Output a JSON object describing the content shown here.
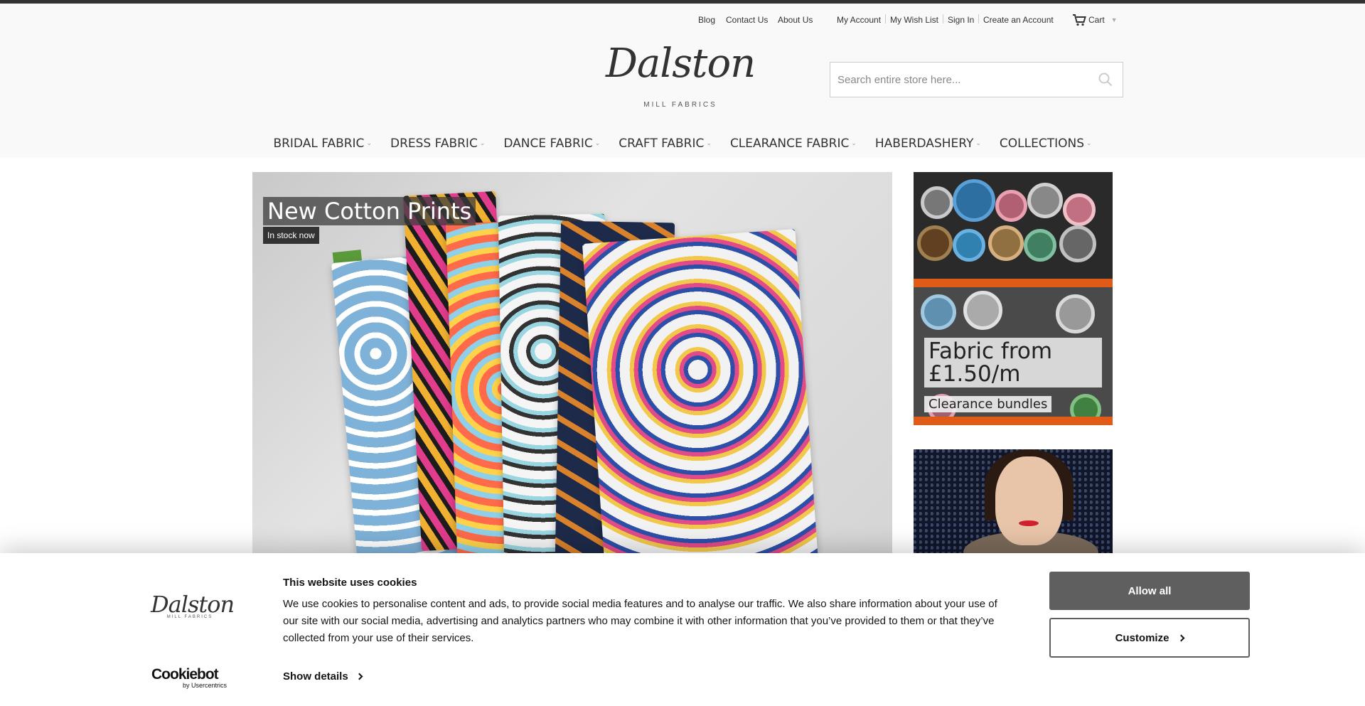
{
  "toplinks": {
    "blog": "Blog",
    "contact": "Contact Us",
    "about": "About Us",
    "my_account": "My Account",
    "wishlist": "My Wish List",
    "sign_in": "Sign In",
    "create_account": "Create an Account",
    "cart": "Cart"
  },
  "logo": {
    "script": "Dalston",
    "sub": "MILL FABRICS"
  },
  "search": {
    "placeholder": "Search entire store here..."
  },
  "nav": {
    "items": [
      {
        "label": "BRIDAL FABRIC"
      },
      {
        "label": "DRESS FABRIC"
      },
      {
        "label": "DANCE FABRIC"
      },
      {
        "label": "CRAFT FABRIC"
      },
      {
        "label": "CLEARANCE FABRIC"
      },
      {
        "label": "HABERDASHERY"
      },
      {
        "label": "COLLECTIONS"
      }
    ]
  },
  "hero": {
    "title": "New Cotton Prints",
    "subtitle": "In stock now"
  },
  "promo1": {
    "title": "Fabric from £1.50/m",
    "subtitle": "Clearance bundles"
  },
  "cookie": {
    "title": "This website uses cookies",
    "text": "We use cookies to personalise content and ads, to provide social media features and to analyse our traffic. We also share information about your use of our site with our social media, advertising and analytics partners who may combine it with other information that you’ve provided to them or that they’ve collected from your use of their services.",
    "show_details": "Show details",
    "allow_all": "Allow all",
    "customize": "Customize",
    "cookiebot_brand": "Cookiebot",
    "cookiebot_sub": "by Usercentrics",
    "logo_script": "Dalston",
    "logo_sub": "MILL FABRICS"
  },
  "colors": {
    "header_bg": "#f9f9f9",
    "top_line": "#333333",
    "allow_button": "#5f5f5f"
  }
}
